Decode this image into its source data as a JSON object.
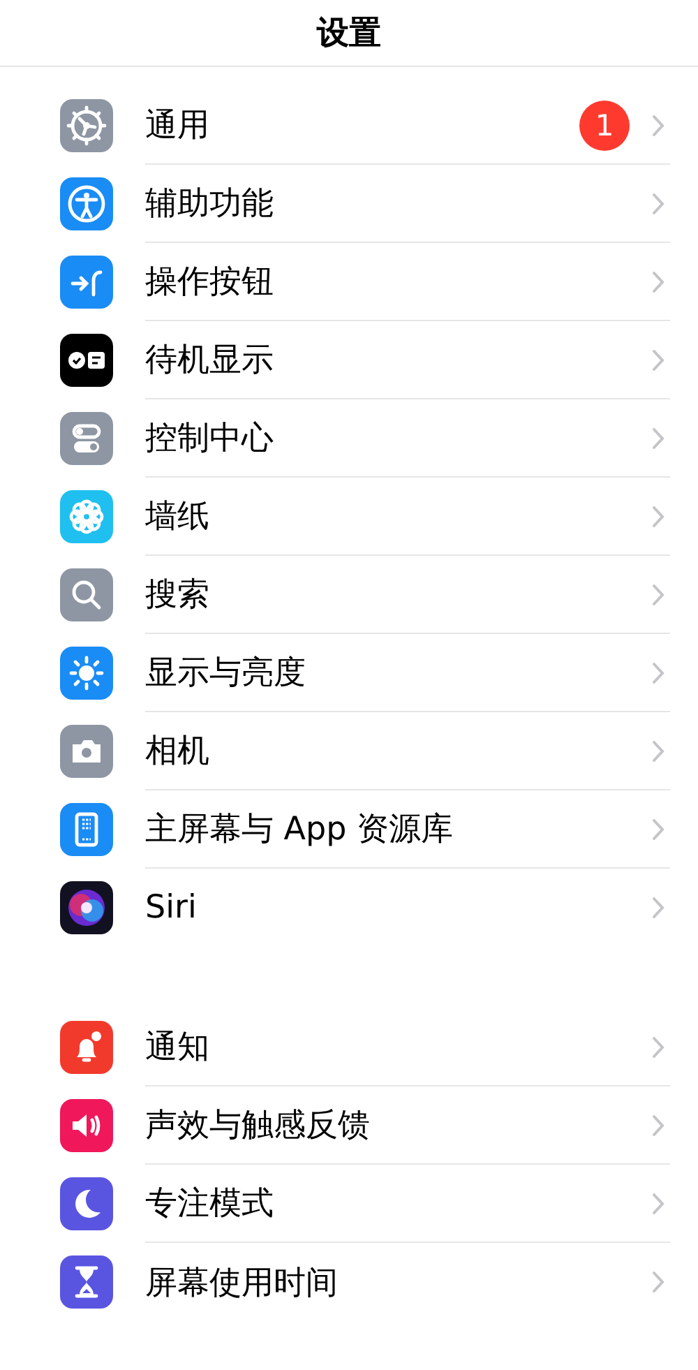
{
  "header": {
    "title": "设置"
  },
  "groups": [
    {
      "items": [
        {
          "label": "通用",
          "kind": "gear",
          "badge": "1"
        },
        {
          "label": "辅助功能",
          "kind": "accessibility"
        },
        {
          "label": "操作按钮",
          "kind": "action"
        },
        {
          "label": "待机显示",
          "kind": "standby"
        },
        {
          "label": "控制中心",
          "kind": "toggles"
        },
        {
          "label": "墙纸",
          "kind": "flower"
        },
        {
          "label": "搜索",
          "kind": "search"
        },
        {
          "label": "显示与亮度",
          "kind": "sun"
        },
        {
          "label": "相机",
          "kind": "camera"
        },
        {
          "label": "主屏幕与 App 资源库",
          "kind": "phone"
        },
        {
          "label": "Siri",
          "kind": "siri"
        }
      ]
    },
    {
      "items": [
        {
          "label": "通知",
          "kind": "bell"
        },
        {
          "label": "声效与触感反馈",
          "kind": "speaker"
        },
        {
          "label": "专注模式",
          "kind": "moon"
        },
        {
          "label": "屏幕使用时间",
          "kind": "hourglass"
        }
      ]
    }
  ]
}
